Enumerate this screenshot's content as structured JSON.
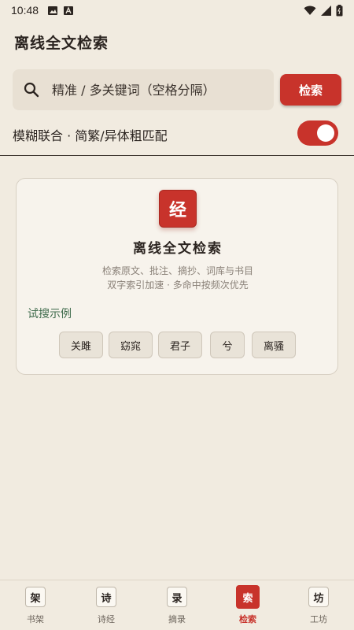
{
  "status_bar": {
    "time": "10:48",
    "left_icons": [
      "image-icon",
      "a-icon"
    ],
    "right_icons": [
      "wifi-icon",
      "signal-icon",
      "battery-icon"
    ]
  },
  "app": {
    "title": "离线全文检索"
  },
  "search": {
    "placeholder": "精准 / 多关键词（空格分隔）",
    "value": "",
    "button_label": "检索"
  },
  "fuzzy": {
    "label": "模糊联合 · 简繁/异体粗匹配",
    "enabled": true
  },
  "card": {
    "badge": "经",
    "title": "离线全文检索",
    "desc_line1": "检索原文、批注、摘抄、词库与书目",
    "desc_line2": "双字索引加速 · 多命中按频次优先",
    "examples_label": "试搜示例",
    "examples": [
      "关雎",
      "窈窕",
      "君子",
      "兮",
      "离骚"
    ]
  },
  "bottom_nav": {
    "items": [
      {
        "icon": "架",
        "label": "书架",
        "active": false
      },
      {
        "icon": "诗",
        "label": "诗经",
        "active": false
      },
      {
        "icon": "录",
        "label": "摘录",
        "active": false
      },
      {
        "icon": "索",
        "label": "检索",
        "active": true
      },
      {
        "icon": "坊",
        "label": "工坊",
        "active": false
      }
    ]
  },
  "colors": {
    "accent": "#c8332b",
    "background": "#f1ebe0",
    "example_label": "#3f6b4c"
  }
}
